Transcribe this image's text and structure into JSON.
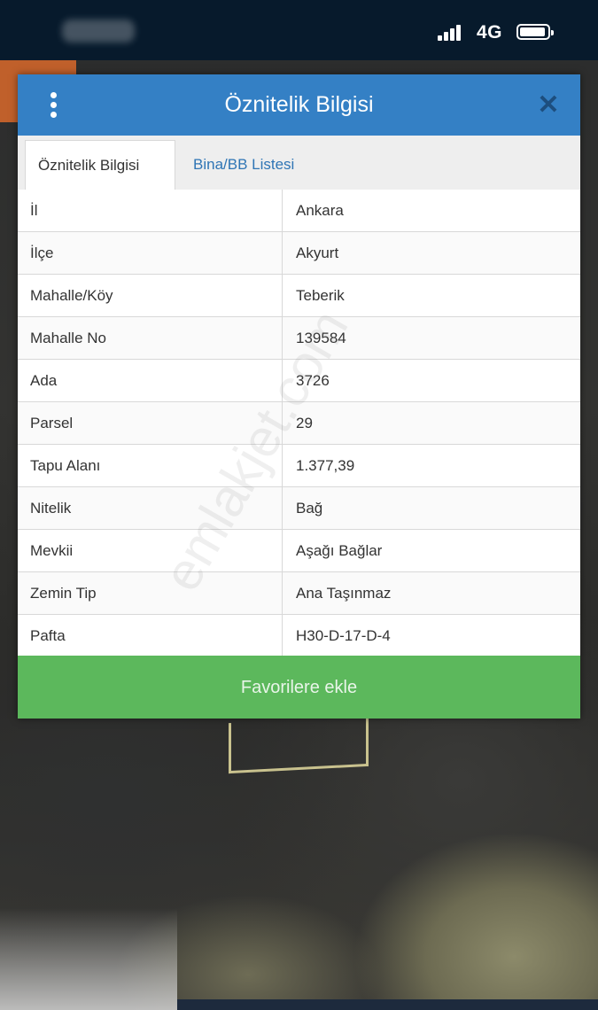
{
  "status_bar": {
    "network_type": "4G"
  },
  "dialog": {
    "title": "Öznitelik Bilgisi",
    "close_label": "✕",
    "tabs": [
      {
        "label": "Öznitelik Bilgisi",
        "active": true
      },
      {
        "label": "Bina/BB Listesi",
        "active": false
      }
    ],
    "rows": [
      {
        "key": "İl",
        "value": "Ankara"
      },
      {
        "key": "İlçe",
        "value": "Akyurt"
      },
      {
        "key": "Mahalle/Köy",
        "value": "Teberik"
      },
      {
        "key": "Mahalle No",
        "value": "139584"
      },
      {
        "key": "Ada",
        "value": "3726"
      },
      {
        "key": "Parsel",
        "value": "29"
      },
      {
        "key": "Tapu Alanı",
        "value": "1.377,39"
      },
      {
        "key": "Nitelik",
        "value": "Bağ"
      },
      {
        "key": "Mevkii",
        "value": "Aşağı Bağlar"
      },
      {
        "key": "Zemin Tip",
        "value": "Ana Taşınmaz"
      },
      {
        "key": "Pafta",
        "value": "H30-D-17-D-4"
      }
    ],
    "favorite_button_label": "Favorilere ekle"
  },
  "watermark": "emlakjet.com",
  "colors": {
    "header": "#3480c5",
    "button": "#5cb85c",
    "tab_link": "#2f75b5",
    "status_bar": "#071a2c"
  }
}
